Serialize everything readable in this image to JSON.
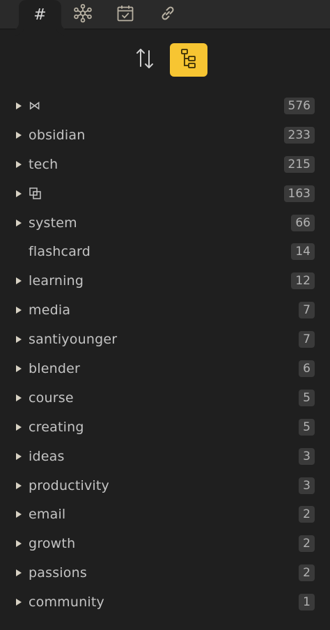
{
  "tabs": [
    {
      "name": "tags",
      "icon": "hash-icon",
      "glyph": "#"
    },
    {
      "name": "graph",
      "icon": "graph-icon"
    },
    {
      "name": "calendar",
      "icon": "calendar-check-icon"
    },
    {
      "name": "links",
      "icon": "link-icon"
    }
  ],
  "toolbar": {
    "sort_icon": "sort-arrows-icon",
    "tree_icon": "tree-view-icon",
    "tree_active": true,
    "accent": "#f7c532"
  },
  "tags": [
    {
      "label": "⋈",
      "count": "576",
      "has_children": true
    },
    {
      "label": "obsidian",
      "count": "233",
      "has_children": true
    },
    {
      "label": "tech",
      "count": "215",
      "has_children": true
    },
    {
      "label": "",
      "icon": "overlap-squares-icon",
      "count": "163",
      "has_children": true
    },
    {
      "label": "system",
      "count": "66",
      "has_children": true
    },
    {
      "label": "flashcard",
      "count": "14",
      "has_children": false
    },
    {
      "label": "learning",
      "count": "12",
      "has_children": true
    },
    {
      "label": "media",
      "count": "7",
      "has_children": true
    },
    {
      "label": "santiyounger",
      "count": "7",
      "has_children": true
    },
    {
      "label": "blender",
      "count": "6",
      "has_children": true
    },
    {
      "label": "course",
      "count": "5",
      "has_children": true
    },
    {
      "label": "creating",
      "count": "5",
      "has_children": true
    },
    {
      "label": "ideas",
      "count": "3",
      "has_children": true
    },
    {
      "label": "productivity",
      "count": "3",
      "has_children": true
    },
    {
      "label": "email",
      "count": "2",
      "has_children": true
    },
    {
      "label": "growth",
      "count": "2",
      "has_children": true
    },
    {
      "label": "passions",
      "count": "2",
      "has_children": true
    },
    {
      "label": "community",
      "count": "1",
      "has_children": true
    }
  ]
}
